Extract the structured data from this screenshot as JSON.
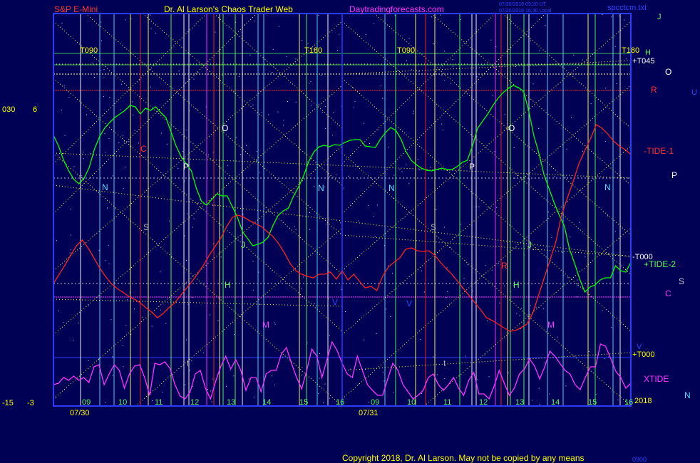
{
  "header": {
    "title_left": "S&P E-Mini",
    "title_center": "Dr. Al Larson's Chaos Trader Web",
    "title_site": "Daytradingforecasts.com",
    "stamp_line1": "07/30/2018 09:20 UT",
    "stamp_line2": "07/30/2018 16:30 Local",
    "file_name": "spcctcm.txt"
  },
  "footer": {
    "copyright": "Copyright 2018, Dr. Al Larson. May not be copied by any means",
    "code": "0900"
  },
  "colors": {
    "bg": "#000055",
    "frame": "#2a3cff",
    "price": "#00ff00",
    "tide1": "#ff2020",
    "xtide": "#ff33ff",
    "yellow": "#ffff00",
    "cyan": "#55ddff",
    "white": "#ffffff",
    "grid": "#ffff44"
  },
  "chart_data": {
    "type": "line",
    "x_days": [
      "07/30",
      "07/31"
    ],
    "x_ticks_day1": [
      "09",
      "10",
      "11",
      "12",
      "13",
      "14",
      "15",
      "16"
    ],
    "x_ticks_day2": [
      "09",
      "10",
      "11",
      "12",
      "13",
      "14",
      "15",
      "16"
    ],
    "year_label": "2018",
    "y_left_labels": {
      "top_a": "030",
      "top_b": "6",
      "bottom_a": "-15",
      "bottom_b": "-3"
    },
    "right_labels": [
      {
        "text": "J",
        "color": "#55ff55"
      },
      {
        "text": "H",
        "color": "#55ff55"
      },
      {
        "text": "+T045",
        "color": "#ffffff"
      },
      {
        "text": "O",
        "color": "#ffffff"
      },
      {
        "text": "R",
        "color": "#ff3333"
      },
      {
        "text": "U",
        "color": "#3344ff"
      },
      {
        "text": "-TIDE-1",
        "color": "#ff3333"
      },
      {
        "text": "P",
        "color": "#ffffff"
      },
      {
        "text": "-T000",
        "color": "#ffffff"
      },
      {
        "text": "+TIDE-2",
        "color": "#55ff55"
      },
      {
        "text": "S",
        "color": "#cccccc"
      },
      {
        "text": "C",
        "color": "#ff33ff"
      },
      {
        "text": "V",
        "color": "#3344ff"
      },
      {
        "text": "+T000",
        "color": "#ffff00"
      },
      {
        "text": "XTIDE",
        "color": "#ff33ff"
      },
      {
        "text": "N",
        "color": "#55ddff"
      }
    ],
    "time_labels": [
      "T090",
      "T180",
      "T090",
      "T180"
    ],
    "planet_labels": [
      {
        "text": "C",
        "color": "#ff3333"
      },
      {
        "text": "P",
        "color": "#ffffff"
      },
      {
        "text": "N",
        "color": "#55ddff"
      },
      {
        "text": "S",
        "color": "#aaaaaa"
      },
      {
        "text": "O",
        "color": "#ffffff"
      },
      {
        "text": "H",
        "color": "#55ff55"
      },
      {
        "text": "J",
        "color": "#55ff55"
      },
      {
        "text": "M",
        "color": "#ff33ff"
      },
      {
        "text": "t",
        "color": "#aaaaaa"
      },
      {
        "text": "N",
        "color": "#55ddff"
      },
      {
        "text": "V",
        "color": "#3344ff"
      },
      {
        "text": "N",
        "color": "#55ddff"
      },
      {
        "text": "P",
        "color": "#ffffff"
      },
      {
        "text": "S",
        "color": "#aaaaaa"
      },
      {
        "text": "V",
        "color": "#3344ff"
      },
      {
        "text": "R",
        "color": "#ff3333"
      },
      {
        "text": "O",
        "color": "#ffffff"
      },
      {
        "text": "H",
        "color": "#55ff55"
      },
      {
        "text": "J",
        "color": "#55ff55"
      },
      {
        "text": "M",
        "color": "#ff33ff"
      },
      {
        "text": "t",
        "color": "#aaaaaa"
      },
      {
        "text": "N",
        "color": "#55ddff"
      }
    ],
    "series": [
      {
        "name": "price",
        "color": "#00ff00",
        "values": [
          190,
          205,
          225,
          240,
          252,
          258,
          250,
          235,
          210,
          192,
          180,
          172,
          165,
          160,
          155,
          148,
          150,
          160,
          152,
          155,
          150,
          158,
          165,
          185,
          205,
          220,
          230,
          240,
          265,
          283,
          288,
          280,
          272,
          275,
          275,
          290,
          305,
          325,
          335,
          345,
          343,
          340,
          333,
          316,
          302,
          296,
          292,
          275,
          262,
          246,
          226,
          213,
          206,
          204,
          206,
          203,
          204,
          200,
          197,
          196,
          196,
          205,
          206,
          207,
          195,
          186,
          179,
          183,
          195,
          213,
          225,
          231,
          236,
          239,
          240,
          238,
          236,
          238,
          238,
          234,
          228,
          225,
          205,
          180,
          170,
          160,
          148,
          138,
          130,
          124,
          120,
          123,
          128,
          155,
          190,
          215,
          245,
          265,
          285,
          302,
          318,
          350,
          370,
          392,
          410,
          403,
          400,
          393,
          390,
          390,
          373,
          380,
          382,
          368
        ]
      },
      {
        "name": "-TIDE-1",
        "color": "#ff2020",
        "values": [
          398,
          385,
          372,
          358,
          345,
          337,
          348,
          362,
          376,
          388,
          398,
          405,
          410,
          416,
          420,
          425,
          432,
          438,
          446,
          440,
          432,
          425,
          415,
          405,
          395,
          384,
          372,
          358,
          346,
          334,
          318,
          305,
          302,
          305,
          310,
          314,
          318,
          325,
          332,
          342,
          355,
          370,
          380,
          385,
          388,
          390,
          385,
          385,
          382,
          392,
          380,
          393,
          385,
          395,
          404,
          402,
          408,
          388,
          375,
          368,
          362,
          350,
          348,
          352,
          353,
          352,
          358,
          368,
          377,
          385,
          395,
          405,
          415,
          425,
          435,
          446,
          450,
          455,
          460,
          465,
          464,
          460,
          455,
          440,
          415,
          390,
          365,
          340,
          302,
          278,
          255,
          230,
          212,
          195,
          175,
          180,
          188,
          198,
          205,
          210,
          217
        ]
      },
      {
        "name": "XTIDE",
        "color": "#ff33ff",
        "values": [
          540,
          538,
          530,
          534,
          528,
          534,
          530,
          537,
          515,
          512,
          540,
          525,
          512,
          520,
          545,
          525,
          514,
          512,
          530,
          555,
          510,
          512,
          508,
          517,
          540,
          556,
          560,
          550,
          525,
          520,
          545,
          560,
          536,
          515,
          500,
          518,
          505,
          520,
          548,
          530,
          530,
          550,
          525,
          520,
          520,
          497,
          488,
          510,
          530,
          546,
          520,
          490,
          500,
          530,
          505,
          480,
          492,
          510,
          525,
          530,
          500,
          520,
          540,
          548,
          555,
          555,
          532,
          510,
          520,
          540,
          550,
          560,
          555,
          548,
          530,
          525,
          540,
          548,
          540,
          530,
          545,
          555,
          534,
          523,
          553,
          553,
          560,
          542,
          520,
          538,
          555,
          545,
          525,
          518,
          504,
          514,
          532,
          515,
          493,
          500,
          510,
          520,
          525,
          540,
          547,
          530,
          515,
          515,
          483,
          486,
          503,
          521,
          530,
          545,
          538
        ]
      }
    ]
  }
}
